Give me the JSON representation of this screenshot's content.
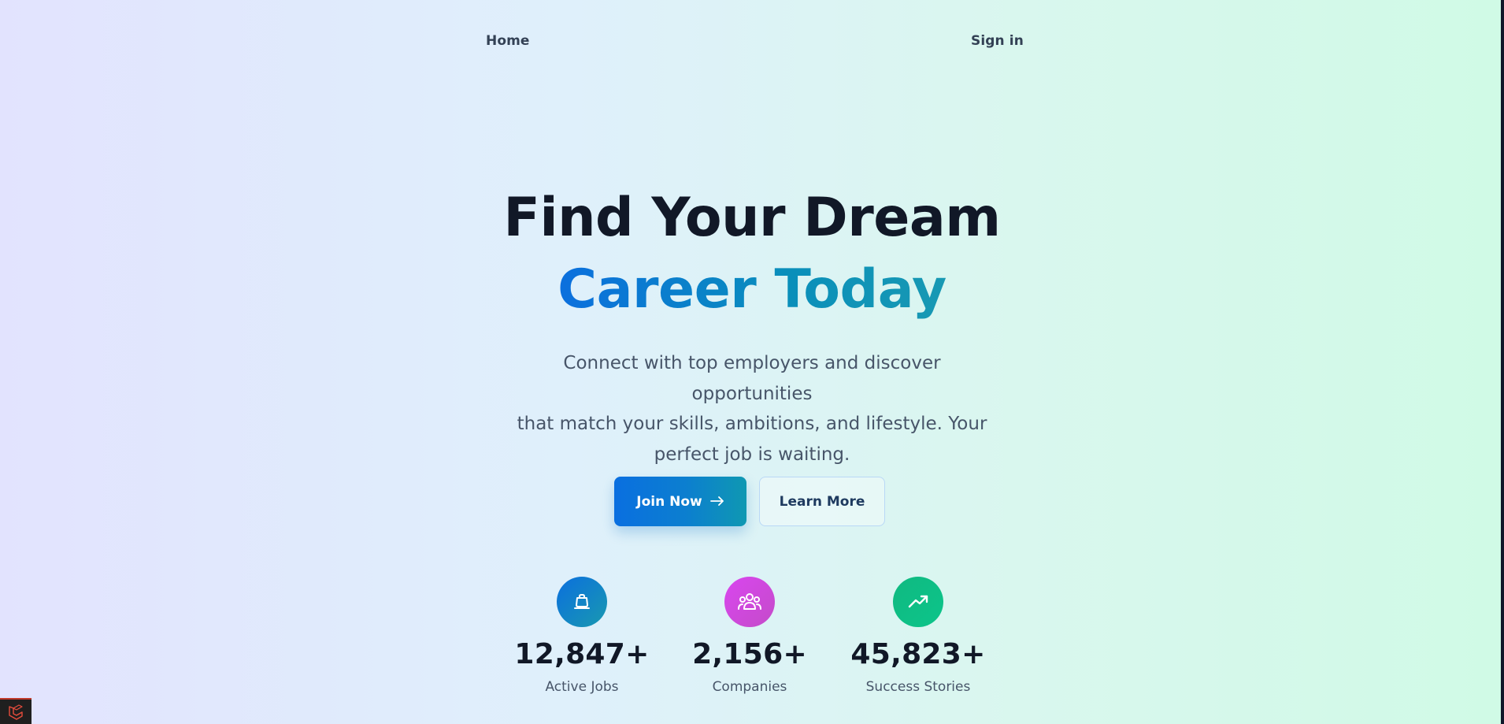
{
  "nav": {
    "home_label": "Home",
    "signin_label": "Sign in"
  },
  "hero": {
    "title_line1": "Find Your Dream",
    "title_line2": "Career Today",
    "subtitle_line1": "Connect with top employers and discover opportunities",
    "subtitle_line2": "that match your skills, ambitions, and lifestyle. Your",
    "subtitle_line3": "perfect job is waiting."
  },
  "actions": {
    "join_label": "Join Now",
    "join_icon": "arrow-right-icon",
    "learn_label": "Learn More"
  },
  "stats": [
    {
      "icon": "briefcase-icon",
      "value": "12,847+",
      "label": "Active Jobs",
      "color": "#0b6fde"
    },
    {
      "icon": "users-icon",
      "value": "2,156+",
      "label": "Companies",
      "color": "#d946ef"
    },
    {
      "icon": "trending-up-icon",
      "value": "45,823+",
      "label": "Success Stories",
      "color": "#10b981"
    }
  ],
  "colors": {
    "accent_blue": "#0b6fde",
    "accent_teal": "#1899b3",
    "heading": "#111827",
    "body_text": "#475569"
  }
}
